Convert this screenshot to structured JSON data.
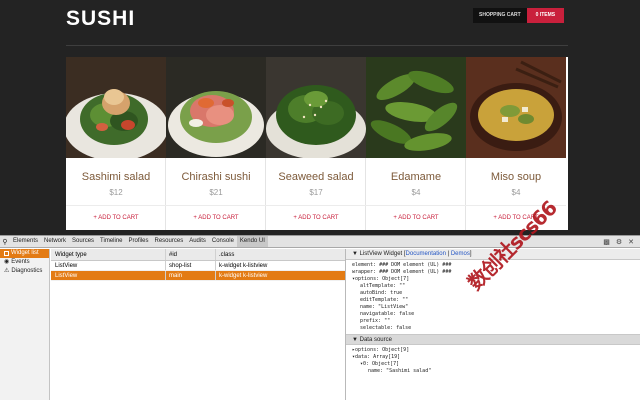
{
  "site": {
    "logo": "SUSHI",
    "cart_label": "SHOPPING CART",
    "cart_items": "0 ITEMS",
    "add_to_cart": "+ ADD TO CART",
    "products": [
      {
        "name": "Sashimi salad",
        "price": "$12"
      },
      {
        "name": "Chirashi sushi",
        "price": "$21"
      },
      {
        "name": "Seaweed salad",
        "price": "$17"
      },
      {
        "name": "Edamame",
        "price": "$4"
      },
      {
        "name": "Miso soup",
        "price": "$4"
      }
    ]
  },
  "devtools": {
    "tabs": [
      "Elements",
      "Network",
      "Sources",
      "Timeline",
      "Profiles",
      "Resources",
      "Audits",
      "Console",
      "Kendo UI"
    ],
    "sidebar": [
      "Widget list",
      "Events",
      "Diagnostics"
    ],
    "table": {
      "headers": [
        "Widget type",
        "#id",
        ".class"
      ],
      "rows": [
        {
          "type": "ListView",
          "id": "shop-list",
          "cls": "k-widget k-listview"
        },
        {
          "type": "ListView",
          "id": "main",
          "cls": "k-widget k-listview"
        }
      ]
    },
    "panel": {
      "title": "ListView Widget",
      "doc_link": "Documentation",
      "demos_link": "Demos",
      "separator": "|",
      "open_bracket": "[",
      "close_bracket": "]",
      "element_line": "element: ### DOM element (UL) ###",
      "wrapper_line": "wrapper: ### DOM element (UL) ###",
      "options_line": "options: Object[7]",
      "alt_template": "altTemplate: \"\"",
      "auto_bind": "autoBind: true",
      "edit_template": "editTemplate: \"\"",
      "name_line": "name: \"ListView\"",
      "navigatable": "navigatable: false",
      "prefix": "prefix: \"\"",
      "selectable": "selectable: false",
      "datasource_title": "Data source",
      "ds_options": "options: Object[9]",
      "ds_data": "data: Array[19]",
      "ds_item": "0: Object[7]",
      "ds_name": "name: \"Sashimi salad\""
    }
  },
  "watermark": "数创社scs66",
  "colors": {
    "accent": "#c9203c",
    "selection": "#e37b14"
  }
}
